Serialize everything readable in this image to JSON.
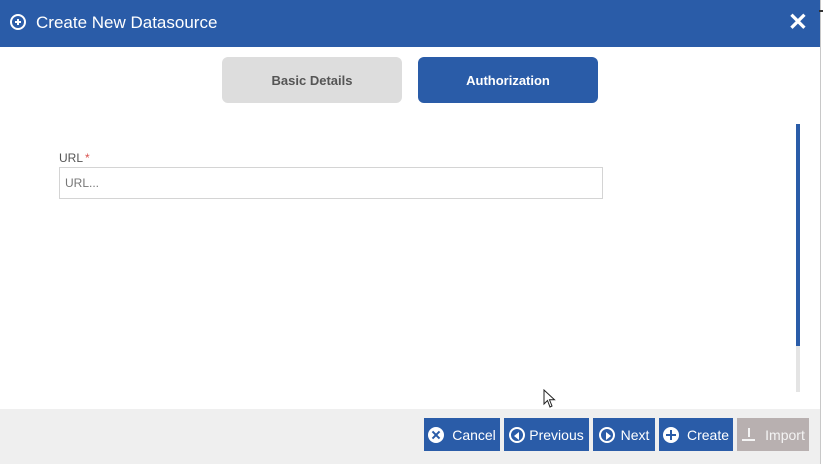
{
  "dialog": {
    "title": "Create New Datasource",
    "close_glyph": "✕"
  },
  "tabs": [
    {
      "label": "Basic Details",
      "active": false
    },
    {
      "label": "Authorization",
      "active": true
    }
  ],
  "form": {
    "url": {
      "label": "URL",
      "required_mark": "*",
      "value": "",
      "placeholder": "URL..."
    }
  },
  "footer": {
    "buttons": {
      "cancel": {
        "label": "Cancel",
        "icon": "close-circle-icon"
      },
      "previous": {
        "label": "Previous",
        "icon": "chevron-left-circle-icon"
      },
      "next": {
        "label": "Next",
        "icon": "chevron-right-circle-icon"
      },
      "create": {
        "label": "Create",
        "icon": "plus-circle-icon"
      },
      "import": {
        "label": "Import",
        "icon": "download-icon",
        "disabled": true
      }
    }
  },
  "colors": {
    "primary": "#2a5ca8",
    "tab_inactive": "#dddddd",
    "required": "#d9534f",
    "disabled": "#b8b0b0",
    "footer_bg": "#efefef"
  }
}
